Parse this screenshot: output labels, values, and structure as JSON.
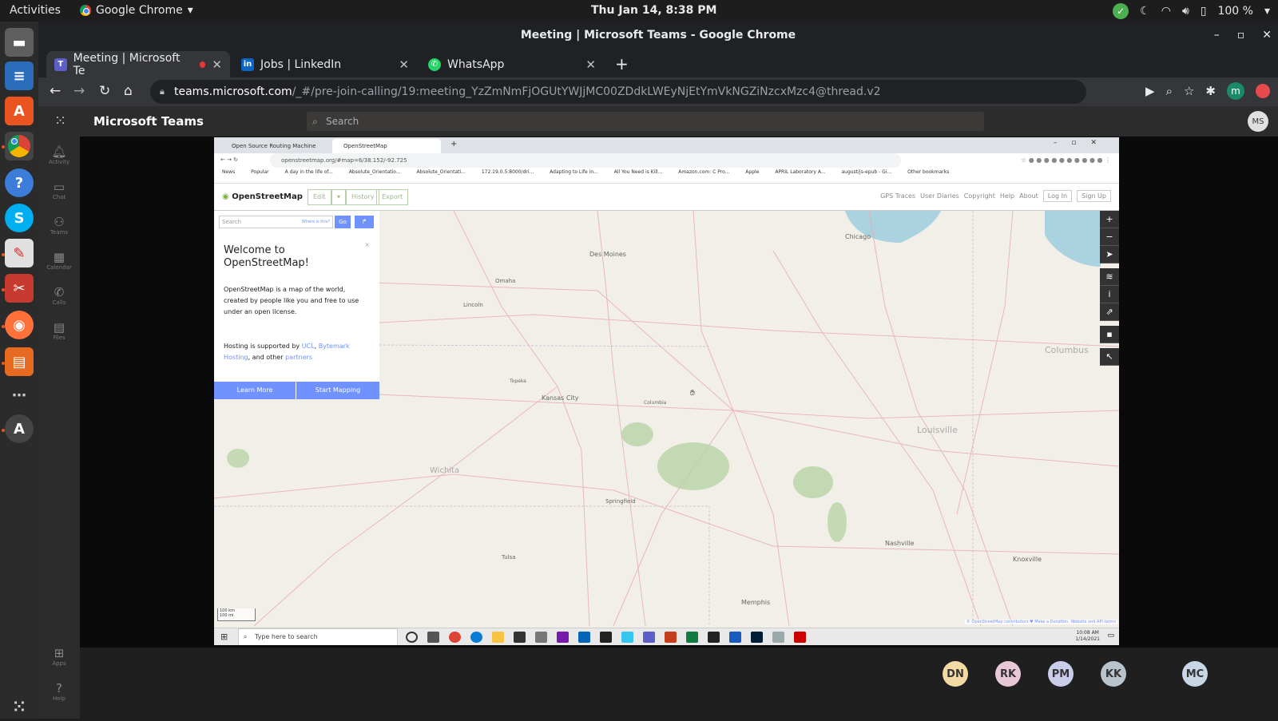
{
  "system": {
    "activities": "Activities",
    "app_name": "Google Chrome",
    "clock": "Thu Jan 14,  8:38 PM",
    "battery": "100 %"
  },
  "chrome": {
    "window_title": "Meeting | Microsoft Teams - Google Chrome",
    "tabs": [
      {
        "label": "Meeting | Microsoft Te",
        "favicon": "teams-icon",
        "active": true
      },
      {
        "label": "Jobs | LinkedIn",
        "favicon": "linkedin-icon",
        "active": false
      },
      {
        "label": "WhatsApp",
        "favicon": "whatsapp-icon",
        "active": false
      }
    ],
    "url_host": "teams.microsoft.com",
    "url_path": "/_#/pre-join-calling/19:meeting_YzZmNmFjOGUtYWJjMC00ZDdkLWEyNjEtYmVkNGZiNzcxMzc4@thread.v2",
    "profile_initial": "m"
  },
  "teams": {
    "title": "Microsoft Teams",
    "search_placeholder": "Search",
    "me_initials": "MS",
    "rail": [
      {
        "label": "Activity",
        "icon": "bell-icon"
      },
      {
        "label": "Chat",
        "icon": "chat-icon"
      },
      {
        "label": "Teams",
        "icon": "teams-icon"
      },
      {
        "label": "Calendar",
        "icon": "calendar-icon"
      },
      {
        "label": "Calls",
        "icon": "phone-icon"
      },
      {
        "label": "Files",
        "icon": "file-icon"
      },
      {
        "label": "Apps",
        "icon": "apps-icon"
      },
      {
        "label": "Help",
        "icon": "help-icon"
      }
    ],
    "participants": [
      {
        "initials": "DN",
        "color": "#f3d9a4"
      },
      {
        "initials": "RK",
        "color": "#e8c8d8"
      },
      {
        "initials": "PM",
        "color": "#c9cdea"
      },
      {
        "initials": "KK",
        "color": "#b9c3cc"
      },
      {
        "initials": "MC",
        "color": "#c8d6e6"
      }
    ]
  },
  "shared_screen": {
    "tabs": [
      "Open Source Routing Machine",
      "OpenStreetMap"
    ],
    "url": "openstreetmap.org/#map=6/38.152/-92.725",
    "bookmarks": [
      "News",
      "Popular",
      "A day in the life of...",
      "Absolute_Orientatio...",
      "Absolute_Orientati...",
      "172.19.0.5:8000/dri...",
      "Adapting to Life in...",
      "All You Need is Kill...",
      "Amazon.com: C Pro...",
      "Apple",
      "APRIL Laboratory A...",
      "august/js-epub - Gi...",
      "Other bookmarks"
    ],
    "osm": {
      "logo": "OpenStreetMap",
      "edit": "Edit",
      "history": "History",
      "export": "Export",
      "nav": [
        "GPS Traces",
        "User Diaries",
        "Copyright",
        "Help",
        "About"
      ],
      "login": "Log In",
      "signup": "Sign Up",
      "search_placeholder": "Search",
      "where": "Where is this?",
      "go": "Go",
      "welcome_title": "Welcome to OpenStreetMap!",
      "welcome_body": "OpenStreetMap is a map of the world, created by people like you and free to use under an open license.",
      "hosting_prefix": "Hosting is supported by ",
      "hosting_ucl": "UCL",
      "hosting_bytemark": "Bytemark Hosting",
      "hosting_mid": ", and other ",
      "hosting_partners": "partners",
      "learn_more": "Learn More",
      "start_mapping": "Start Mapping",
      "attribution": "© OpenStreetMap contributors ♥ Make a Donation. Website and API terms",
      "scale_km": "100 km",
      "scale_mi": "100 mi",
      "cities": [
        "Des Moines",
        "Chicago",
        "Kansas City",
        "Columbus",
        "Louisville",
        "Omaha",
        "Lincoln",
        "Wichita",
        "Springfield",
        "Tulsa",
        "Nashville",
        "Memphis",
        "Knoxville",
        "Topeka",
        "Columbia"
      ]
    },
    "windows": {
      "search_placeholder": "Type here to search",
      "time": "10:08 AM",
      "date": "1/14/2021"
    }
  }
}
